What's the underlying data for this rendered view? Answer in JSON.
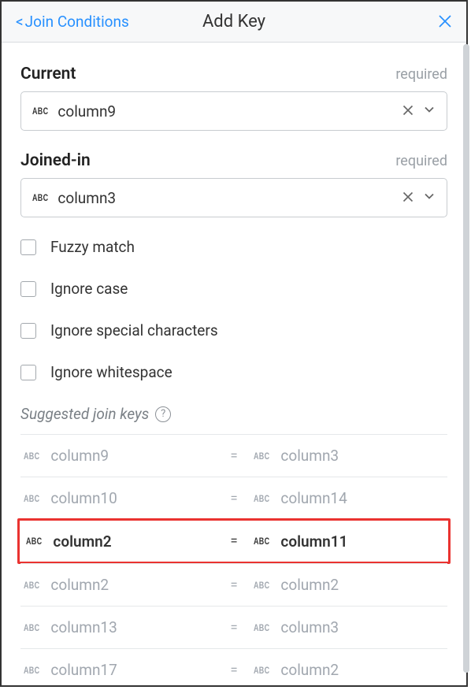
{
  "header": {
    "back_label": "Join Conditions",
    "title": "Add Key"
  },
  "current": {
    "label": "Current",
    "required": "required",
    "value": "column9"
  },
  "joined": {
    "label": "Joined-in",
    "required": "required",
    "value": "column3"
  },
  "checks": {
    "fuzzy": "Fuzzy match",
    "ignore_case": "Ignore case",
    "ignore_special": "Ignore special characters",
    "ignore_ws": "Ignore whitespace"
  },
  "suggest": {
    "title": "Suggested join keys",
    "rows": [
      {
        "left": "column9",
        "right": "column3",
        "hl": false
      },
      {
        "left": "column10",
        "right": "column14",
        "hl": false
      },
      {
        "left": "column2",
        "right": "column11",
        "hl": true
      },
      {
        "left": "column2",
        "right": "column2",
        "hl": false
      },
      {
        "left": "column13",
        "right": "column3",
        "hl": false
      },
      {
        "left": "column17",
        "right": "column2",
        "hl": false
      }
    ]
  },
  "abc": "ABC"
}
